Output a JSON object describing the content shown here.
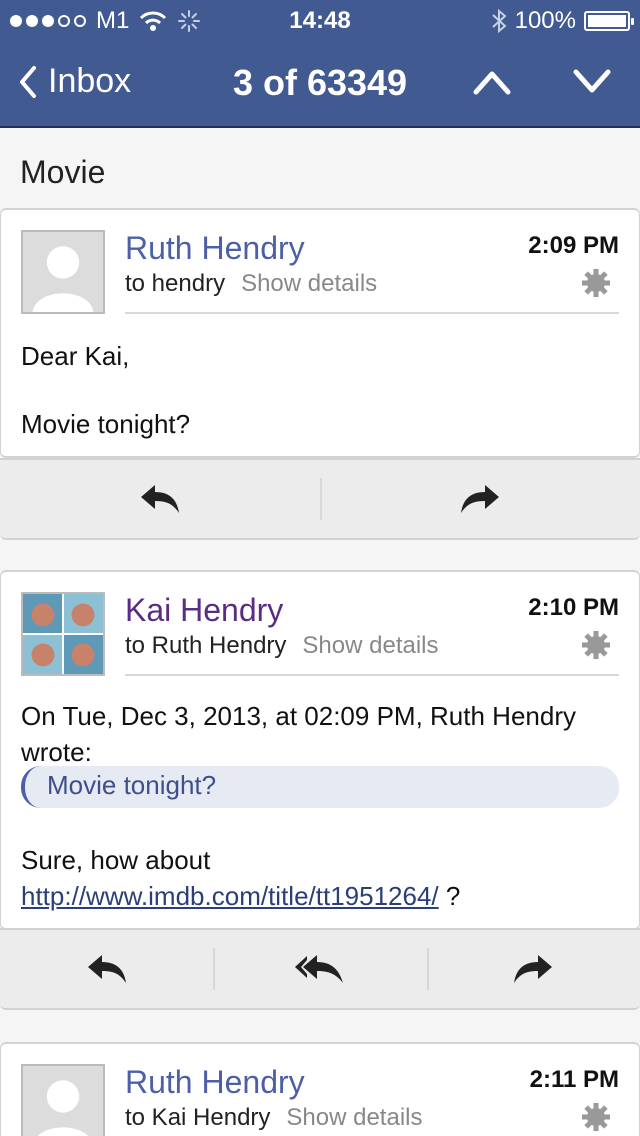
{
  "status_bar": {
    "carrier": "M1",
    "time": "14:48",
    "battery": "100%",
    "battery_level": 1.0
  },
  "nav": {
    "back_label": "Inbox",
    "title": "3 of 63349"
  },
  "subject": "Movie",
  "messages": [
    {
      "sender": "Ruth Hendry",
      "to": "to hendry",
      "show_details": "Show details",
      "time": "2:09 PM",
      "body_lines": [
        "Dear Kai,",
        "Movie tonight?"
      ]
    },
    {
      "sender": "Kai Hendry",
      "to": "to Ruth Hendry",
      "show_details": "Show details",
      "time": "2:10 PM",
      "quote_header_1": "On Tue, Dec 3, 2013, at 02:09 PM, Ruth Hendry",
      "quote_header_2": "wrote:",
      "quoted": "Movie tonight?",
      "reply_line": "Sure, how about",
      "link": "http://www.imdb.com/title/tt1951264/",
      "link_suffix": " ?"
    },
    {
      "sender": "Ruth Hendry",
      "to": "to Kai Hendry",
      "show_details": "Show details",
      "time": "2:11 PM"
    }
  ],
  "colors": {
    "header": "#425a92",
    "sender_link": "#4c5fa8",
    "sender_visited": "#5a2d84"
  }
}
